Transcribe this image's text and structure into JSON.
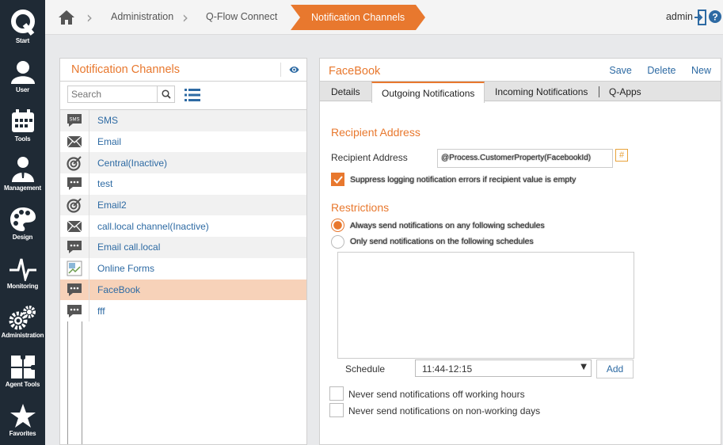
{
  "nav": [
    {
      "label": "Start",
      "icon": "q-logo-icon"
    },
    {
      "label": "User",
      "icon": "user-icon"
    },
    {
      "label": "Tools",
      "icon": "calendar-icon"
    },
    {
      "label": "Management",
      "icon": "management-icon"
    },
    {
      "label": "Design",
      "icon": "palette-icon"
    },
    {
      "label": "Monitoring",
      "icon": "pulse-icon"
    },
    {
      "label": "Administration",
      "icon": "gears-icon"
    },
    {
      "label": "Agent Tools",
      "icon": "puzzle-icon"
    },
    {
      "label": "Favorites",
      "icon": "star-icon"
    }
  ],
  "breadcrumb": {
    "items": [
      "Administration",
      "Q-Flow Connect"
    ],
    "active": "Notification Channels"
  },
  "user": {
    "name": "admin"
  },
  "left_panel": {
    "title": "Notification Channels",
    "search_placeholder": "Search",
    "channels": [
      {
        "name": "SMS",
        "icon": "sms-icon"
      },
      {
        "name": "Email",
        "icon": "envelope-icon"
      },
      {
        "name": "Central(Inactive)",
        "icon": "target-icon"
      },
      {
        "name": "test",
        "icon": "chat-icon"
      },
      {
        "name": "Email2",
        "icon": "target-icon"
      },
      {
        "name": "call.local channel(Inactive)",
        "icon": "envelope-icon"
      },
      {
        "name": "Email call.local",
        "icon": "chat-icon"
      },
      {
        "name": "Online Forms",
        "icon": "broken-image-icon"
      },
      {
        "name": "FaceBook",
        "icon": "chat-icon",
        "selected": true
      },
      {
        "name": "fff",
        "icon": "chat-icon"
      }
    ]
  },
  "right_panel": {
    "title": "FaceBook",
    "actions": {
      "save": "Save",
      "delete": "Delete",
      "new": "New"
    },
    "tabs": [
      "Details",
      "Outgoing Notifications",
      "Incoming Notifications",
      "Q-Apps"
    ],
    "active_tab": "Outgoing Notifications",
    "recipient_section": "Recipient Address",
    "recipient_label": "Recipient Address",
    "recipient_value": "@Process.CustomerProperty(FacebookId)",
    "hash_label": "#",
    "suppress_label": "Suppress logging notification errors if recipient value is empty",
    "restrictions_section": "Restrictions",
    "radio_always": "Always send notifications on any following schedules",
    "radio_only": "Only send notifications on the following schedules",
    "schedule_label": "Schedule",
    "schedule_value": "11:44-12:15",
    "add_label": "Add",
    "never_off_hours": "Never send notifications off working hours",
    "never_non_working": "Never send notifications on non-working days"
  },
  "colors": {
    "accent": "#e8782e",
    "nav_bg": "#1f2a35",
    "link": "#2d6aa3",
    "selected_row": "#f7d2b9"
  }
}
